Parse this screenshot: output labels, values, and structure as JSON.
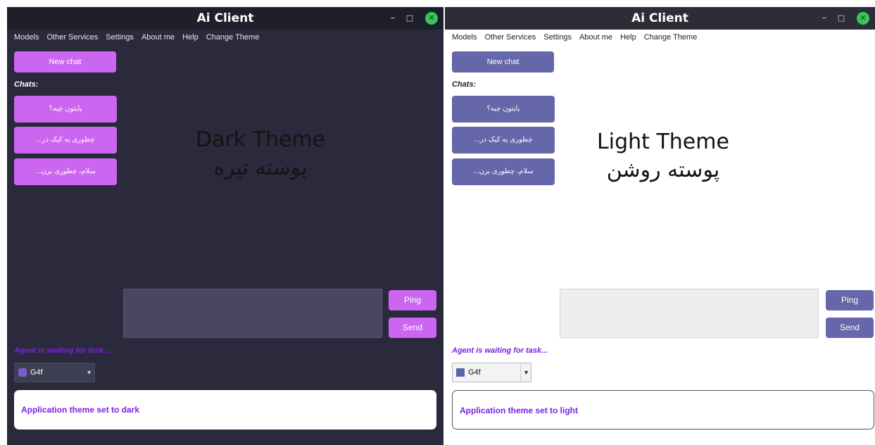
{
  "windows": [
    {
      "title": "Ai Client",
      "controls": {
        "minimize": "–",
        "maximize": "□",
        "close": "✕"
      },
      "menu": [
        "Models",
        "Other Services",
        "Settings",
        "About me",
        "Help",
        "Change Theme"
      ],
      "new_chat": "New chat",
      "chats_label": "Chats:",
      "chats": [
        "پایتون چیه؟",
        "چطوری یه کیک در...",
        "سلام، چطوری برن..."
      ],
      "overlay": {
        "line1": "Dark Theme",
        "line2": "پوسته تیره"
      },
      "ping": "Ping",
      "send": "Send",
      "status": "Agent is waiting for task...",
      "model_select": {
        "value": "G4f",
        "icon": "g4f-icon"
      },
      "log": "Application theme set to dark",
      "colors": {
        "background": "#2a2a3c",
        "button": "#cc66f0",
        "accent_text": "#7a22e0"
      }
    },
    {
      "title": "Ai Client",
      "controls": {
        "minimize": "–",
        "maximize": "□",
        "close": "✕"
      },
      "menu": [
        "Models",
        "Other Services",
        "Settings",
        "About me",
        "Help",
        "Change Theme"
      ],
      "new_chat": "New chat",
      "chats_label": "Chats:",
      "chats": [
        "پایتون چیه؟",
        "چطوری یه کیک در...",
        "سلام، چطوری برن..."
      ],
      "overlay": {
        "line1": "Light Theme",
        "line2": "پوسته روشن"
      },
      "ping": "Ping",
      "send": "Send",
      "status": "Agent is waiting for task...",
      "model_select": {
        "value": "G4f",
        "icon": "g4f-icon"
      },
      "log": "Application theme set to light",
      "colors": {
        "background": "#ffffff",
        "button": "#6666aa",
        "accent_text": "#7a22e0"
      }
    }
  ]
}
